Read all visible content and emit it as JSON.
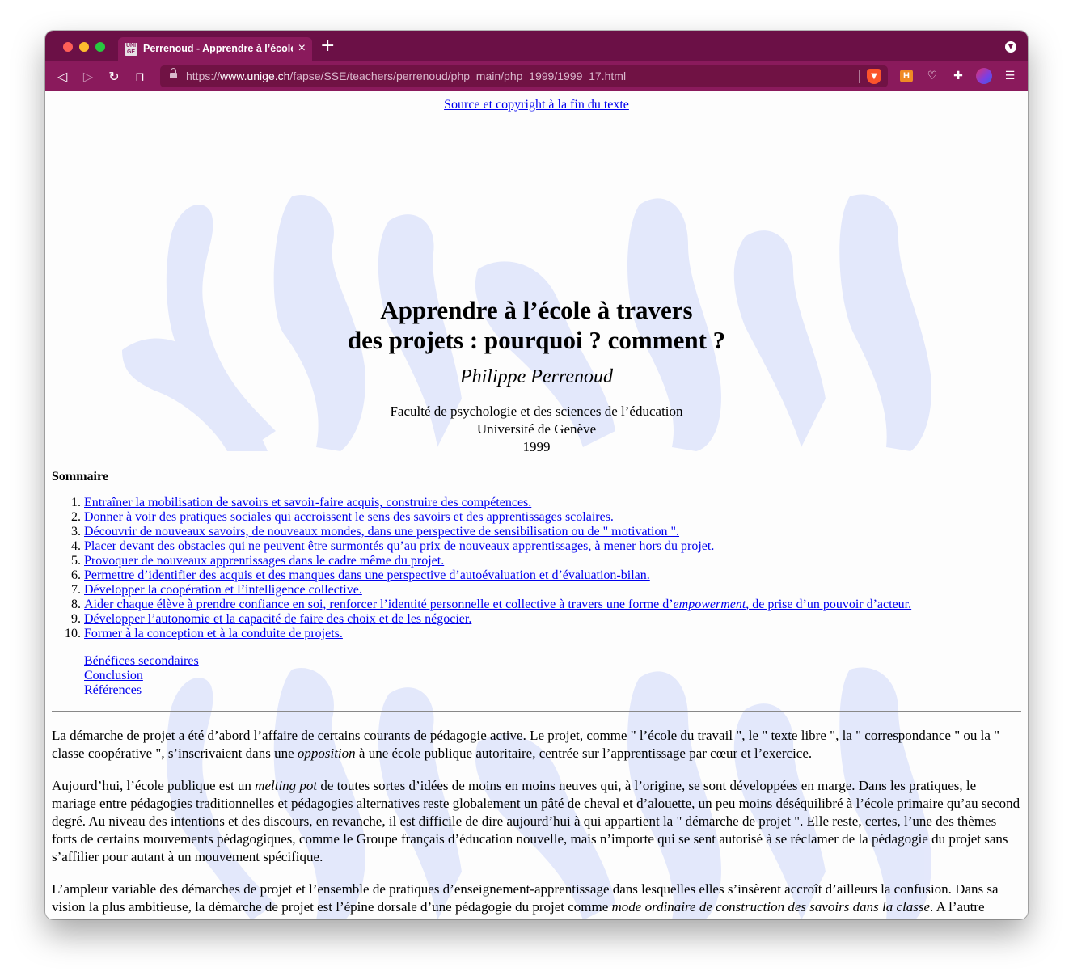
{
  "browser": {
    "tab": {
      "favicon_text": "UNI GE",
      "title": "Perrenoud - Apprendre à l’école à travers des projets"
    },
    "url": {
      "scheme": "https://",
      "host": "www.unige.ch",
      "path": "/fapse/SSE/teachers/perrenoud/php_main/php_1999/1999_17.html"
    },
    "extension_h_label": "H",
    "colors": {
      "tabbar": "#6b1046",
      "toolbar": "#8a1a5c",
      "watermark": "#e1e6fb"
    }
  },
  "page": {
    "source_link": "Source et copyright à la fin du texte",
    "title_line1": "Apprendre à l’école à travers",
    "title_line2": "des projets : pourquoi ? comment ?",
    "author": "Philippe Perrenoud",
    "affiliation_line1": "Faculté de psychologie et des sciences de l’éducation",
    "affiliation_line2": "Université de Genève",
    "year": "1999",
    "sommaire_heading": "Sommaire",
    "toc": [
      "Entraîner la mobilisation de savoirs et savoir-faire acquis, construire des compétences.",
      "Donner à voir des pratiques sociales qui accroissent le sens des savoirs et des apprentissages scolaires.",
      "Découvrir de nouveaux savoirs, de nouveaux mondes, dans une perspective de sensibilisation ou de \" motivation \".",
      "Placer devant des obstacles qui ne peuvent être surmontés qu’au prix de nouveaux apprentissages, à mener hors du projet.",
      "Provoquer de nouveaux apprentissages dans le cadre même du projet.",
      "Permettre d’identifier des acquis et des manques dans une perspective d’autoévaluation et d’évaluation-bilan.",
      "Développer la coopération et l’intelligence collective.",
      {
        "before": "Aider chaque élève à prendre confiance en soi, renforcer l’identité personnelle et collective à travers une forme d’",
        "em": "empowerment",
        "after": ", de prise d’un pouvoir d’acteur."
      },
      "Développer l’autonomie et la capacité de faire des choix et de les négocier.",
      "Former à la conception et à la conduite de projets."
    ],
    "extra_links": [
      "Bénéfices secondaires",
      "Conclusion",
      "Références"
    ],
    "paragraph1": {
      "a": "La démarche de projet a été d’abord l’affaire de certains courants de pédagogie active. Le projet, comme \" l’école du travail \", le \" texte libre \", la \" correspondance \" ou la \" classe coopérative \", s’inscrivaient dans une ",
      "em": "opposition",
      "b": " à une école publique autoritaire, centrée sur l’apprentissage par cœur et l’exercice."
    },
    "paragraph2": {
      "a": "Aujourd’hui, l’école publique est un ",
      "em": "melting pot",
      "b": " de toutes sortes d’idées de moins en moins neuves qui, à l’origine, se sont développées en marge. Dans les pratiques, le mariage entre pédagogies traditionnelles et pédagogies alternatives reste globalement un pâté de cheval et d’alouette, un peu moins déséquilibré à l’école primaire qu’au second degré. Au niveau des intentions et des discours, en revanche, il est difficile de dire aujourd’hui à qui appartient la \" démarche de projet \". Elle reste, certes, l’une des thèmes forts de certains mouvements pédagogiques, comme le Groupe français d’éducation nouvelle, mais n’importe qui se sent autorisé à se réclamer de la pédagogie du projet sans s’affilier pour autant à un mouvement spécifique."
    },
    "paragraph3": {
      "a": "L’ampleur variable des démarches de projet et l’ensemble de pratiques d’enseignement-apprentissage dans lesquelles elles s’insèrent accroît d’ailleurs la confusion. Dans sa vision la plus ambitieuse, la démarche de projet est l’épine dorsale d’une pédagogie du projet comme ",
      "em": "mode ordinaire de construction des savoirs dans la classe",
      "b": ". A l’autre extrême, c’est une activité parmi beaucoup d’autres, qui jouxte la résolution d’énigmes, les mots croisés ou le concours de calcul mental dans le"
    }
  }
}
